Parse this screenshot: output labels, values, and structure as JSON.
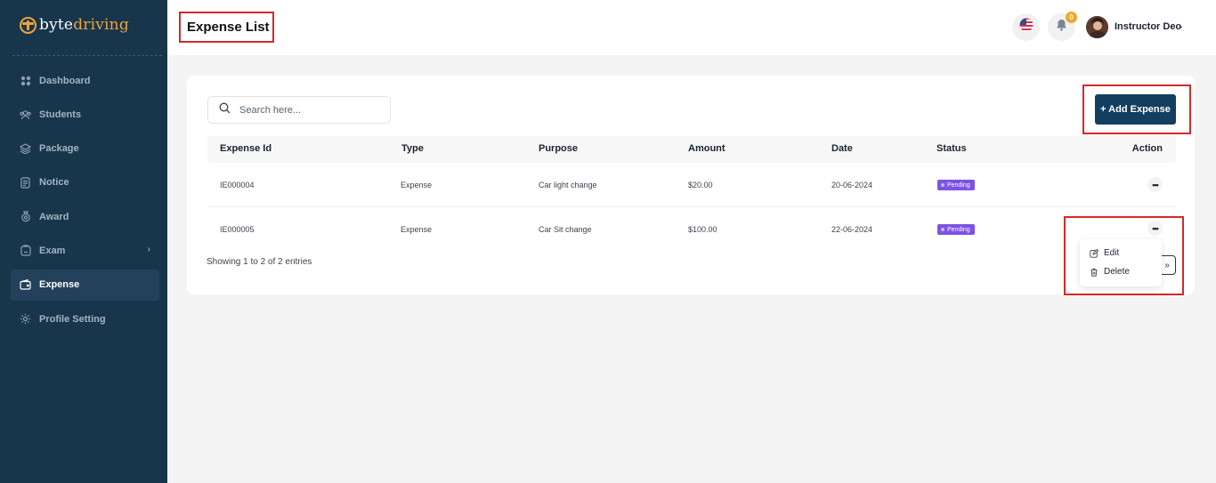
{
  "brand": {
    "logo_part1": "byte",
    "logo_part2": "driving",
    "accent": "#f0a23a",
    "sidebar_bg": "#17364c"
  },
  "sidebar": {
    "items": [
      {
        "label": "Dashboard",
        "icon": "grid-icon",
        "active": false
      },
      {
        "label": "Students",
        "icon": "users-icon",
        "active": false
      },
      {
        "label": "Package",
        "icon": "layers-icon",
        "active": false
      },
      {
        "label": "Notice",
        "icon": "document-icon",
        "active": false
      },
      {
        "label": "Award",
        "icon": "award-icon",
        "active": false
      },
      {
        "label": "Exam",
        "icon": "exam-icon",
        "active": false,
        "has_submenu": true
      },
      {
        "label": "Expense",
        "icon": "wallet-icon",
        "active": true
      },
      {
        "label": "Profile Setting",
        "icon": "gear-icon",
        "active": false
      }
    ]
  },
  "header": {
    "title": "Expense List",
    "language_icon": "us-flag-icon",
    "notification_count": "0",
    "user_name": "Instructor Deo"
  },
  "toolbar": {
    "search_placeholder": "Search here...",
    "add_label": "+ Add Expense",
    "button_color": "#133e5f"
  },
  "table": {
    "columns": [
      "Expense Id",
      "Type",
      "Purpose",
      "Amount",
      "Date",
      "Status",
      "Action"
    ],
    "rows": [
      {
        "id": "IE000004",
        "type": "Expense",
        "purpose": "Car light change",
        "amount": "$20.00",
        "date": "20-06-2024",
        "status": "Pending"
      },
      {
        "id": "IE000005",
        "type": "Expense",
        "purpose": "Car Sit change",
        "amount": "$100.00",
        "date": "22-06-2024",
        "status": "Pending"
      }
    ],
    "status_color": "#7b53e4"
  },
  "footer": {
    "showing": "Showing 1 to 2 of 2 entries",
    "next_page": "»"
  },
  "action_menu": {
    "edit": "Edit",
    "delete": "Delete"
  }
}
